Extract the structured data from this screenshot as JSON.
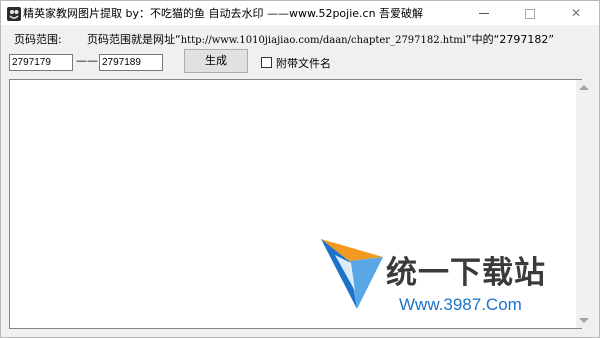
{
  "window": {
    "title": "精英家教网图片提取 by：不吃猫的鱼 自动去水印 ——www.52pojie.cn 吾爱破解",
    "icon": "app-icon"
  },
  "form": {
    "range_label": "页码范围:",
    "hint_prefix": "页码范围就是网址“",
    "hint_url": "http://www.1010jiajiao.com/daan/chapter_2797182.html",
    "hint_suffix": "”中的“2797182”",
    "from_value": "2797179",
    "separator": "——",
    "to_value": "2797189",
    "generate_label": "生成",
    "attach_filename_label": "附带文件名",
    "attach_filename_checked": false
  },
  "output": {
    "text": ""
  },
  "watermark": {
    "title": "统一下载站",
    "url": "Www.3987.Com"
  },
  "colors": {
    "watermark_blue": "#1e73c8",
    "watermark_orange": "#f29a1f"
  }
}
